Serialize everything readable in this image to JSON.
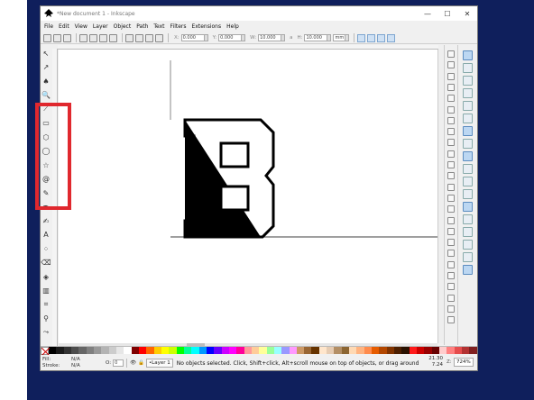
{
  "window": {
    "title": "*New document 1 - Inkscape",
    "min": "—",
    "max": "☐",
    "close": "✕"
  },
  "menu": [
    "File",
    "Edit",
    "View",
    "Layer",
    "Object",
    "Path",
    "Text",
    "Filters",
    "Extensions",
    "Help"
  ],
  "controls": {
    "x_label": "X:",
    "x_value": "0.000",
    "y_label": "Y:",
    "y_value": "0.000",
    "w_label": "W:",
    "w_value": "10.000",
    "lock": "a",
    "h_label": "H:",
    "h_value": "10.000",
    "unit": "mm"
  },
  "tools": [
    {
      "name": "selector-tool",
      "glyph": "↖"
    },
    {
      "name": "node-tool",
      "glyph": "↗"
    },
    {
      "name": "tweak-tool",
      "glyph": "♠"
    },
    {
      "name": "zoom-tool",
      "glyph": "🔍"
    },
    {
      "name": "measure-tool",
      "glyph": "⟋"
    },
    {
      "name": "rectangle-tool",
      "glyph": "▭"
    },
    {
      "name": "3d-box-tool",
      "glyph": "⬡"
    },
    {
      "name": "ellipse-tool",
      "glyph": "◯"
    },
    {
      "name": "star-tool",
      "glyph": "☆"
    },
    {
      "name": "spiral-tool",
      "glyph": "@"
    },
    {
      "name": "pencil-tool",
      "glyph": "✎"
    },
    {
      "name": "pen-tool",
      "glyph": "✒"
    },
    {
      "name": "calligraphy-tool",
      "glyph": "✍"
    },
    {
      "name": "text-tool",
      "glyph": "A"
    },
    {
      "name": "spray-tool",
      "glyph": "⁘"
    },
    {
      "name": "eraser-tool",
      "glyph": "⌫"
    },
    {
      "name": "bucket-tool",
      "glyph": "◈"
    },
    {
      "name": "gradient-tool",
      "glyph": "▥"
    },
    {
      "name": "mesh-tool",
      "glyph": "⌗"
    },
    {
      "name": "dropper-tool",
      "glyph": "⚲"
    },
    {
      "name": "connector-tool",
      "glyph": "⤳"
    }
  ],
  "palette": [
    "#000000",
    "#1a1a1a",
    "#333333",
    "#4d4d4d",
    "#666666",
    "#808080",
    "#999999",
    "#b3b3b3",
    "#cccccc",
    "#e6e6e6",
    "#ffffff",
    "#800000",
    "#ff0000",
    "#ff6600",
    "#ffcc00",
    "#ffff00",
    "#ccff00",
    "#00ff00",
    "#00ff99",
    "#00ffff",
    "#0099ff",
    "#0000ff",
    "#6600ff",
    "#cc00ff",
    "#ff00ff",
    "#ff0099",
    "#ff9999",
    "#ffcc99",
    "#ffff99",
    "#99ff99",
    "#99ffff",
    "#9999ff",
    "#ff99ff",
    "#cc9966",
    "#996633",
    "#663300",
    "#ffe6cc",
    "#e6ccb3",
    "#b38f66",
    "#8c6633",
    "#ffd9b3",
    "#ffb380",
    "#ff8c4d",
    "#e65c00",
    "#b34700",
    "#803300",
    "#4d1f00",
    "#2a1100",
    "#ff1a1a",
    "#cc0000",
    "#990000",
    "#660000",
    "#ffcccc",
    "#ff8080",
    "#e64d4d",
    "#b33333",
    "#802020"
  ],
  "status": {
    "fill_label": "Fill:",
    "fill_value": "N/A",
    "stroke_label": "Stroke:",
    "stroke_value": "N/A",
    "opacity_label": "O:",
    "opacity_value": "0",
    "layer": "•Layer 1",
    "message": "No objects selected. Click, Shift+click, Alt+scroll mouse on top of objects, or drag around objects to sel...",
    "x": "21.30",
    "y": "7.24",
    "zoom_label": "Z:",
    "zoom": "724%"
  },
  "colors": {
    "highlight_box": "#e0282e",
    "background": "#0f1f5c"
  }
}
